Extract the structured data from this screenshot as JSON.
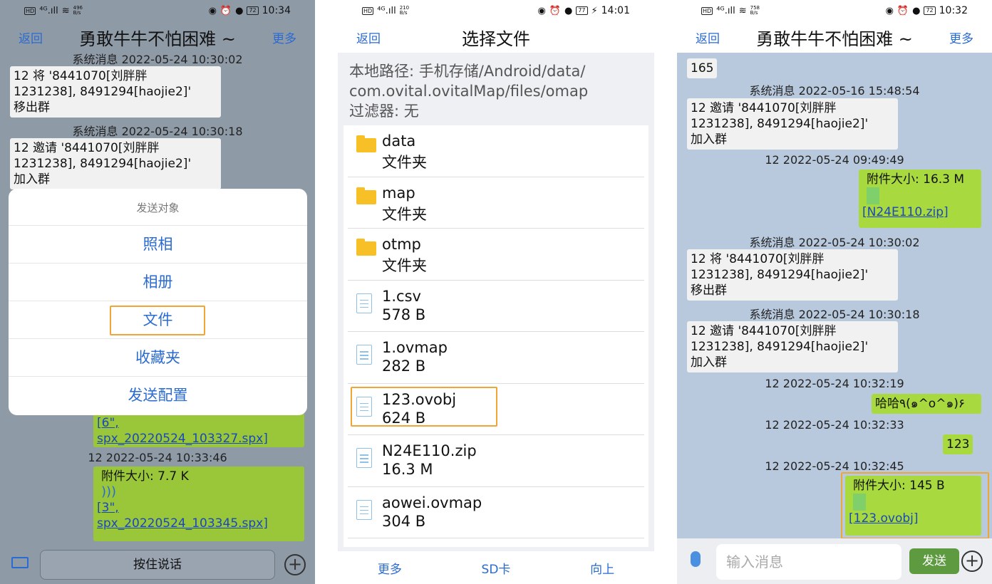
{
  "status_bars": [
    {
      "speed_top": "496",
      "speed_unit": "B/s",
      "battery": "72",
      "time": "10:34"
    },
    {
      "speed_top": "210",
      "speed_unit": "B/s",
      "battery": "77",
      "time": "14:01"
    },
    {
      "speed_top": "758",
      "speed_unit": "B/s",
      "battery": "72",
      "time": "10:32"
    }
  ],
  "panel1": {
    "header": {
      "back": "返回",
      "title": "勇敢牛牛不怕困难 ~",
      "more": "更多"
    },
    "messages": [
      {
        "sys": "系统消息 2022-05-24 10:30:02",
        "lines": [
          "12 将 '8441070[刘胖胖",
          "1231238], 8491294[haojie2]'",
          "移出群"
        ]
      },
      {
        "sys": "系统消息 2022-05-24 10:30:18",
        "lines": [
          "12 邀请 '8441070[刘胖胖",
          "1231238], 8491294[haojie2]'",
          "加入群"
        ]
      }
    ],
    "sheet": {
      "title": "发送对象",
      "options": [
        "照相",
        "相册",
        "文件",
        "收藏夹",
        "发送配置"
      ]
    },
    "under_sheet": {
      "link_lines": [
        "[6\",",
        "spx_20220524_103327.spx]"
      ],
      "sys": "12 2022-05-24 10:33:46",
      "attach_size": "附件大小: 7.7 K",
      "link2_lines": [
        "[3\",",
        "spx_20220524_103345.spx]"
      ]
    },
    "talk_button": "按住说话"
  },
  "panel2": {
    "header": {
      "back": "返回",
      "title": "选择文件"
    },
    "path_lines": [
      "本地路径: 手机存储/Android/data/",
      "com.ovital.ovitalMap/files/omap",
      "过滤器: 无"
    ],
    "files": [
      {
        "name": "data",
        "sub": "文件夹",
        "icon": "folder-icon"
      },
      {
        "name": "map",
        "sub": "文件夹",
        "icon": "folder-icon"
      },
      {
        "name": "otmp",
        "sub": "文件夹",
        "icon": "folder-icon"
      },
      {
        "name": "1.csv",
        "sub": "578 B",
        "icon": "file-icon"
      },
      {
        "name": "1.ovmap",
        "sub": "282 B",
        "icon": "file-icon"
      },
      {
        "name": "123.ovobj",
        "sub": "624 B",
        "icon": "file-icon"
      },
      {
        "name": "N24E110.zip",
        "sub": "16.3 M",
        "icon": "file-icon"
      },
      {
        "name": "aowei.ovmap",
        "sub": "304 B",
        "icon": "file-icon"
      }
    ],
    "bottom": [
      "更多",
      "SD卡",
      "向上"
    ]
  },
  "panel3": {
    "header": {
      "back": "返回",
      "title": "勇敢牛牛不怕困难 ~",
      "more": "更多"
    },
    "msg_165": "165",
    "sys1": "系统消息 2022-05-16 15:48:54",
    "invite_lines": [
      "12 邀请 '8441070[刘胖胖",
      "1231238], 8491294[haojie2]'",
      "加入群"
    ],
    "ts1": "12 2022-05-24 09:49:49",
    "attach1_size": "附件大小: 16.3 M",
    "attach1_link": "[N24E110.zip]",
    "sys2": "系统消息 2022-05-24 10:30:02",
    "remove_lines": [
      "12 将 '8441070[刘胖胖",
      "1231238], 8491294[haojie2]'",
      "移出群"
    ],
    "sys3": "系统消息 2022-05-24 10:30:18",
    "invite2_lines": [
      "12 邀请 '8441070[刘胖胖",
      "1231238], 8491294[haojie2]'",
      "加入群"
    ],
    "ts2": "12 2022-05-24 10:32:19",
    "haha": "哈哈٩(๑^o^๑)۶",
    "ts3": "12 2022-05-24 10:32:33",
    "msg_123": "123",
    "ts4": "12 2022-05-24 10:32:45",
    "attach2_size": "附件大小: 145 B",
    "attach2_link": "[123.ovobj]",
    "input_placeholder": "输入消息",
    "send": "发送"
  }
}
